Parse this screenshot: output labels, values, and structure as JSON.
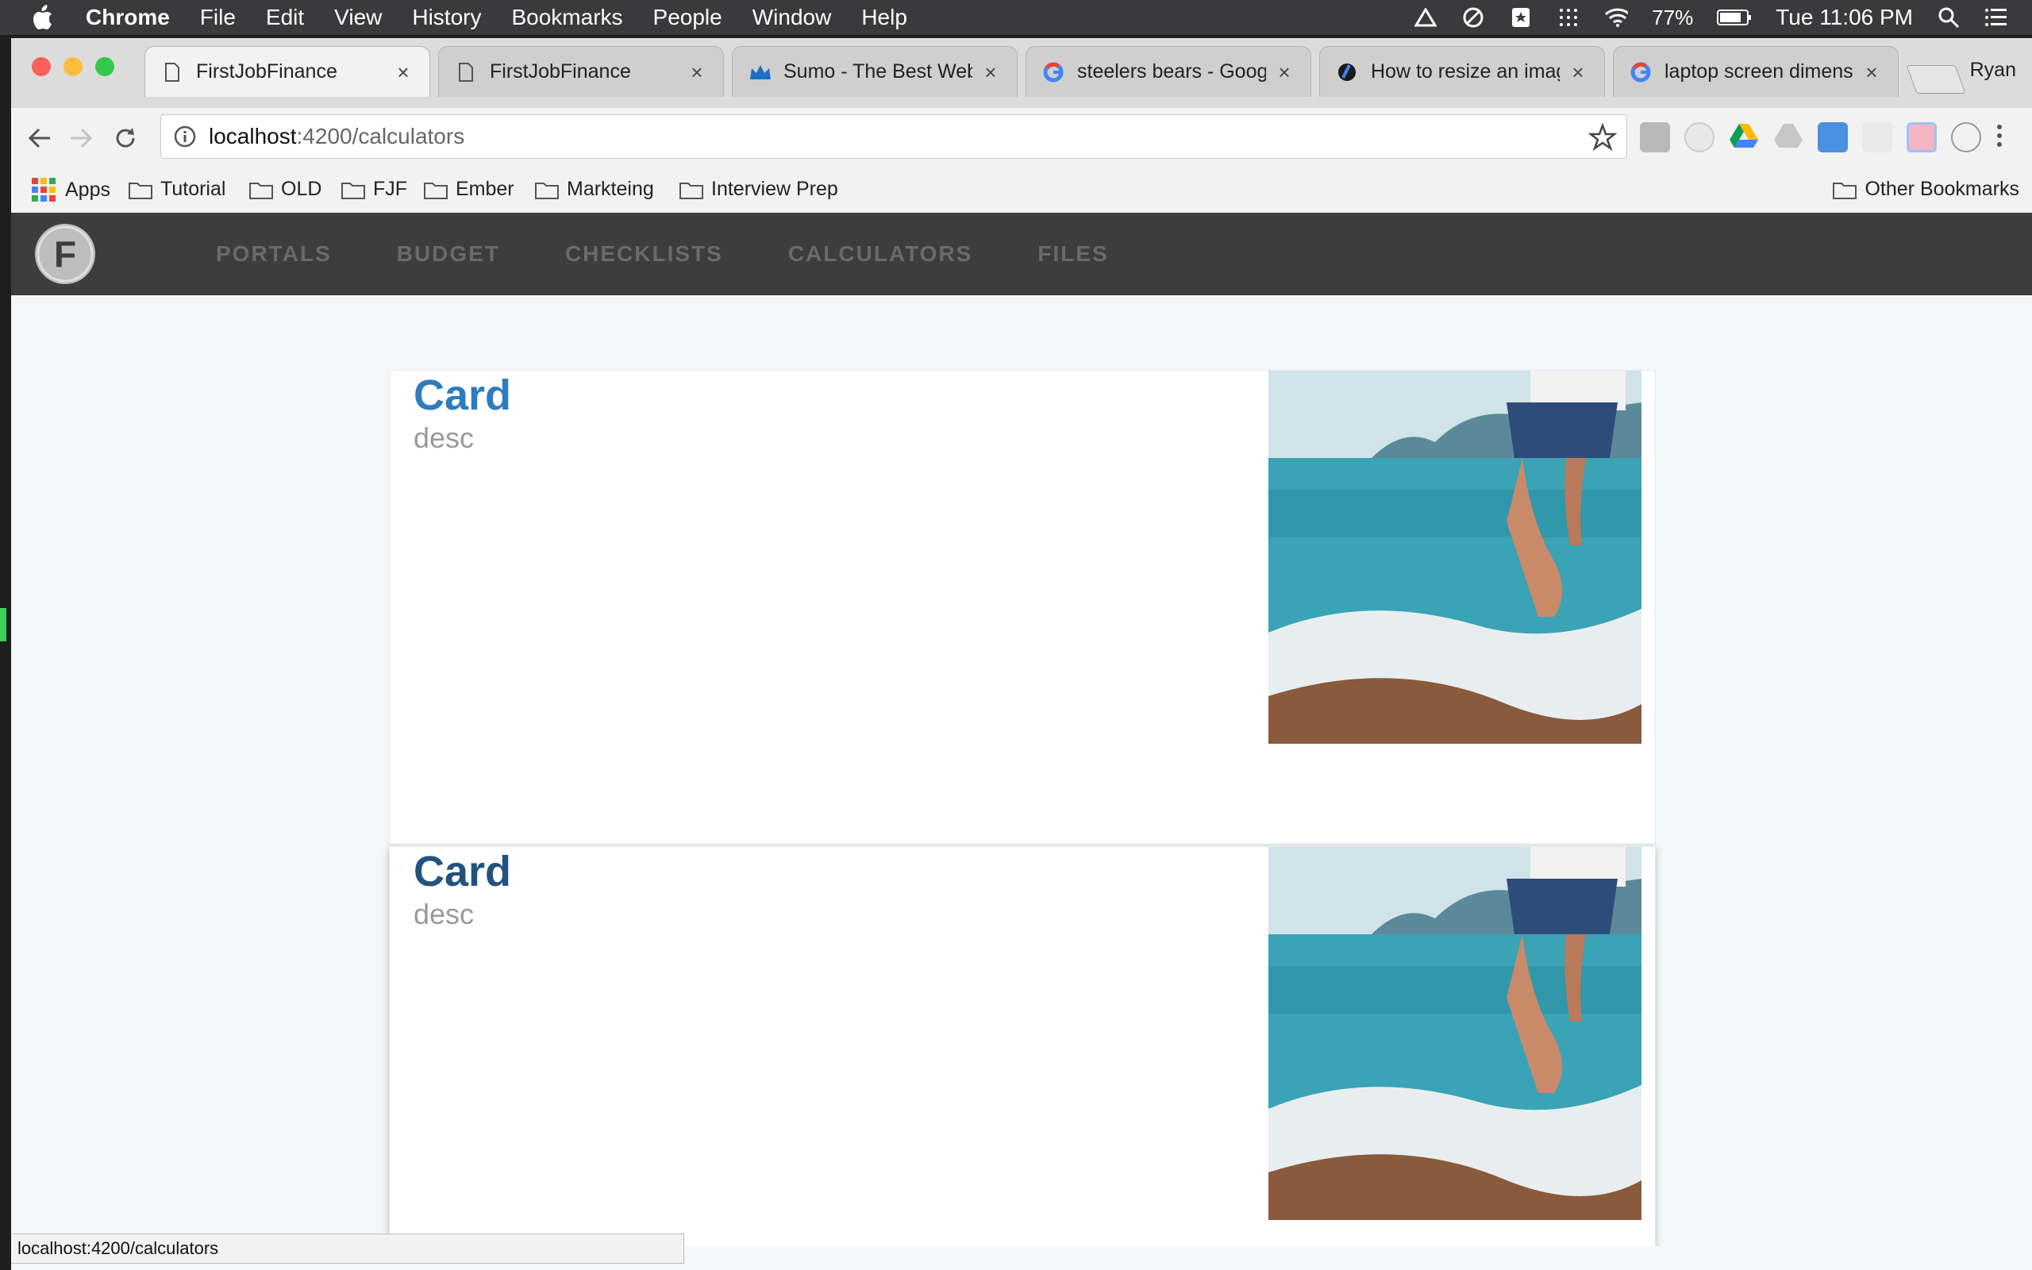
{
  "menubar": {
    "app": "Chrome",
    "items": [
      "File",
      "Edit",
      "View",
      "History",
      "Bookmarks",
      "People",
      "Window",
      "Help"
    ],
    "battery": "77%",
    "clock": "Tue 11:06 PM"
  },
  "tabs": [
    {
      "title": "FirstJobFinance",
      "icon": "page-icon"
    },
    {
      "title": "FirstJobFinance",
      "icon": "page-icon"
    },
    {
      "title": "Sumo - The Best Webs",
      "icon": "crown-icon"
    },
    {
      "title": "steelers bears - Google",
      "icon": "google-icon"
    },
    {
      "title": "How to resize an image",
      "icon": "loading-icon"
    },
    {
      "title": "laptop screen dimensio",
      "icon": "google-icon"
    }
  ],
  "profile": "Ryan",
  "address": {
    "host": "localhost",
    "path": ":4200/calculators"
  },
  "bookmarks": {
    "apps": "Apps",
    "folders": [
      "Tutorial",
      "OLD",
      "FJF",
      "Ember",
      "Markteing",
      "Interview Prep"
    ],
    "other": "Other Bookmarks"
  },
  "app_nav": {
    "logo": "F",
    "links": [
      "PORTALS",
      "BUDGET",
      "CHECKLISTS",
      "CALCULATORS",
      "FILES"
    ]
  },
  "cards": [
    {
      "title": "Card",
      "desc": "desc",
      "title_color": "#2f7bbf"
    },
    {
      "title": "Card",
      "desc": "desc",
      "title_color": "#24527e"
    }
  ],
  "status_url": "localhost:4200/calculators",
  "colors": {
    "nav_bg": "#3d3d3d",
    "page_bg": "#f4f7fa",
    "card_title": "#2f7bbf"
  }
}
